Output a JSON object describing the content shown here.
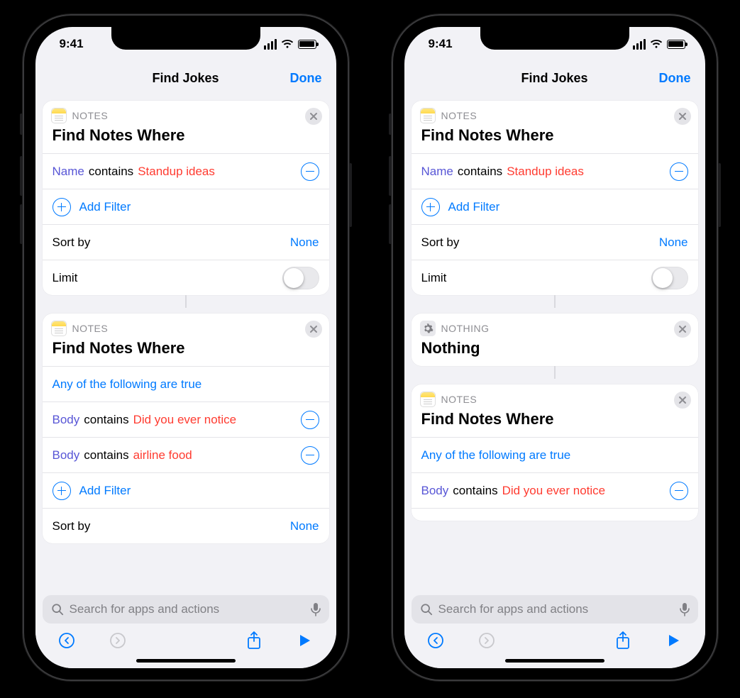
{
  "status": {
    "time": "9:41"
  },
  "nav": {
    "title": "Find Jokes",
    "done": "Done"
  },
  "search": {
    "placeholder": "Search for apps and actions"
  },
  "labels": {
    "notes_header": "NOTES",
    "nothing_header": "NOTHING",
    "find_notes_title": "Find Notes Where",
    "nothing_title": "Nothing",
    "add_filter": "Add Filter",
    "sort_by": "Sort by",
    "none": "None",
    "limit": "Limit",
    "any_true": "Any of the following are true"
  },
  "left": {
    "card1": {
      "filters": [
        {
          "field": "Name",
          "op": "contains",
          "value": "Standup ideas"
        }
      ],
      "sort": "None",
      "limit_on": false
    },
    "card2": {
      "any_true": true,
      "filters": [
        {
          "field": "Body",
          "op": "contains",
          "value": "Did you ever notice"
        },
        {
          "field": "Body",
          "op": "contains",
          "value": "airline food"
        }
      ],
      "sort": "None"
    }
  },
  "right": {
    "card1": {
      "filters": [
        {
          "field": "Name",
          "op": "contains",
          "value": "Standup ideas"
        }
      ],
      "sort": "None",
      "limit_on": false
    },
    "card3": {
      "any_true": true,
      "filters": [
        {
          "field": "Body",
          "op": "contains",
          "value": "Did you ever notice"
        }
      ]
    }
  }
}
